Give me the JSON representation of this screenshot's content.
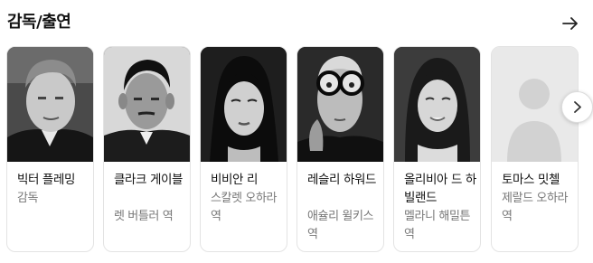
{
  "section": {
    "title": "감독/출연",
    "more_icon": "arrow-right-icon",
    "next_icon": "chevron-right-icon"
  },
  "people": [
    {
      "name": "빅터 플레밍",
      "role": "감독",
      "photo": "portrait-photo"
    },
    {
      "name": "클라크 게이블",
      "role": "렛 버틀러 역",
      "photo": "portrait-photo"
    },
    {
      "name": "비비안 리",
      "role": "스칼렛 오하라 역",
      "photo": "portrait-photo"
    },
    {
      "name": "레슬리 하워드",
      "role": "애슐리 윌키스 역",
      "photo": "portrait-photo"
    },
    {
      "name": "올리비아 드 하빌랜드",
      "role": "멜라니 해밀튼 역",
      "photo": "portrait-photo"
    },
    {
      "name": "토마스 밋첼",
      "role": "제랄드 오하라 역",
      "photo": "placeholder-person-icon"
    }
  ]
}
